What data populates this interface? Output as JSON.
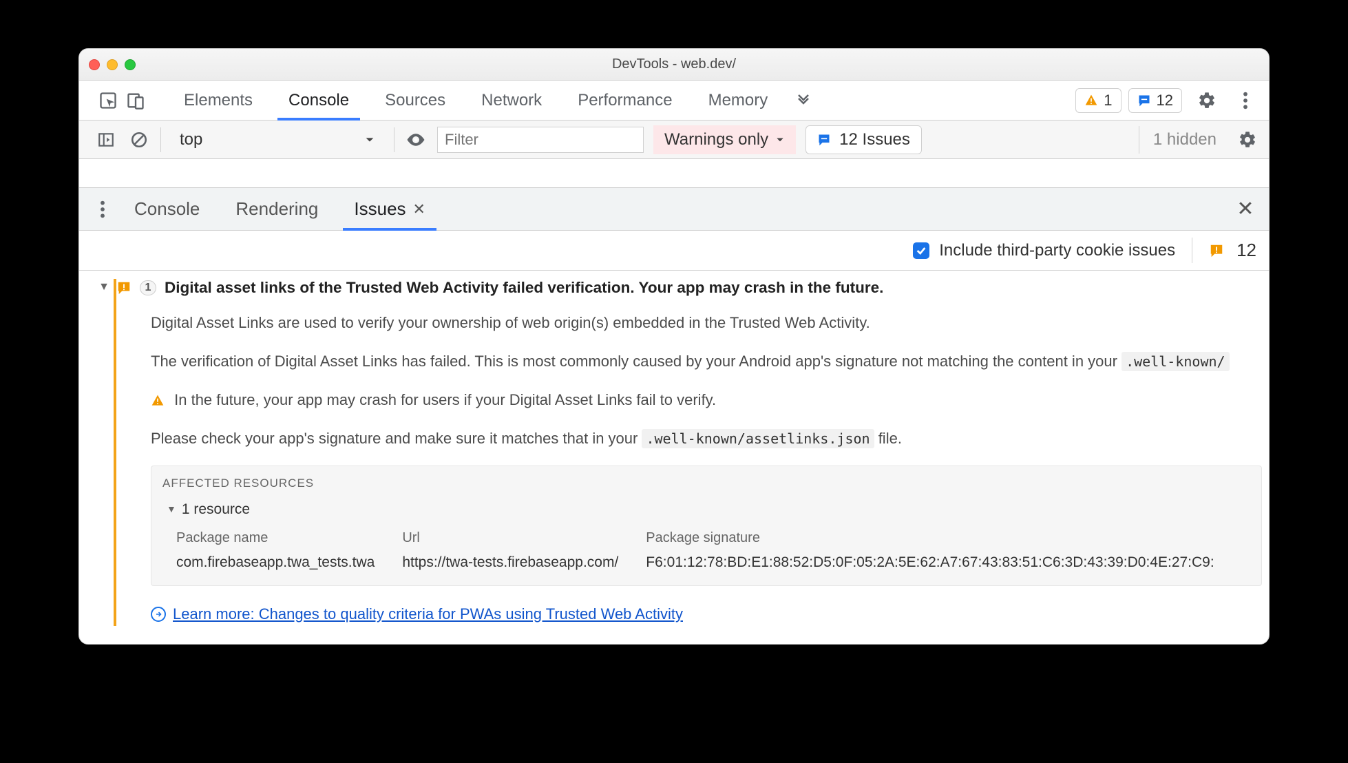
{
  "window": {
    "title": "DevTools - web.dev/"
  },
  "main_tabs": {
    "items": [
      "Elements",
      "Console",
      "Sources",
      "Network",
      "Performance",
      "Memory"
    ],
    "active_index": 1
  },
  "pills": {
    "warnings_count": "1",
    "issues_count": "12"
  },
  "console_bar": {
    "context": "top",
    "filter_placeholder": "Filter",
    "level": "Warnings only",
    "issues_label": "12 Issues",
    "hidden": "1 hidden"
  },
  "drawer_tabs": {
    "items": [
      "Console",
      "Rendering",
      "Issues"
    ],
    "active_index": 2
  },
  "issues_toolbar": {
    "checkbox_label": "Include third-party cookie issues",
    "count": "12"
  },
  "issue": {
    "count_chip": "1",
    "title": "Digital asset links of the Trusted Web Activity failed verification. Your app may crash in the future.",
    "p1": "Digital Asset Links are used to verify your ownership of web origin(s) embedded in the Trusted Web Activity.",
    "p2_a": "The verification of Digital Asset Links has failed. This is most commonly caused by your Android app's signature not matching the content in your ",
    "p2_code": ".well-known/",
    "p3": "In the future, your app may crash for users if your Digital Asset Links fail to verify.",
    "p4_a": "Please check your app's signature and make sure it matches that in your ",
    "p4_code": ".well-known/assetlinks.json",
    "p4_b": " file.",
    "affected": {
      "heading": "Affected Resources",
      "sub": "1 resource",
      "cols": {
        "pkg_h": "Package name",
        "pkg_v": "com.firebaseapp.twa_tests.twa",
        "url_h": "Url",
        "url_v": "https://twa-tests.firebaseapp.com/",
        "sig_h": "Package signature",
        "sig_v": "F6:01:12:78:BD:E1:88:52:D5:0F:05:2A:5E:62:A7:67:43:83:51:C6:3D:43:39:D0:4E:27:C9:"
      }
    },
    "learn_more": "Learn more: Changes to quality criteria for PWAs using Trusted Web Activity"
  }
}
